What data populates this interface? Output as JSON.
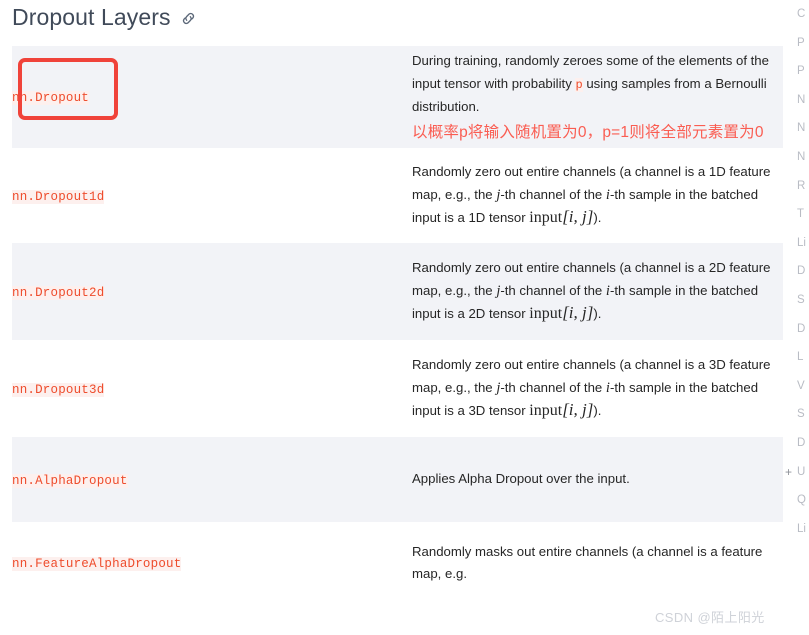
{
  "heading": {
    "title": "Dropout Layers",
    "anchor_icon": "link-icon"
  },
  "table": {
    "rows": [
      {
        "name": "nn.Dropout",
        "desc_pre": "During training, randomly zeroes some of the elements of the input tensor with probability ",
        "desc_var": "p",
        "desc_post": " using samples from a Bernoulli distribution.",
        "annotation_cn": "以概率p将输入随机置为0，p=1则将全部元素置为0",
        "striped": true,
        "highlighted": true
      },
      {
        "name": "nn.Dropout1d",
        "desc_pre": "Randomly zero out entire channels (a channel is a 1D feature map, e.g., the ",
        "var_j": "j",
        "desc_mid": "-th channel of the ",
        "var_i": "i",
        "desc_mid2": "-th sample in the batched input is a 1D tensor ",
        "math_input": "input",
        "math_index": "[i, j]",
        "desc_post": ").",
        "striped": false,
        "highlighted": false
      },
      {
        "name": "nn.Dropout2d",
        "desc_pre": "Randomly zero out entire channels (a channel is a 2D feature map, e.g., the ",
        "var_j": "j",
        "desc_mid": "-th channel of the ",
        "var_i": "i",
        "desc_mid2": "-th sample in the batched input is a 2D tensor ",
        "math_input": "input",
        "math_index": "[i, j]",
        "desc_post": ").",
        "striped": true,
        "highlighted": false
      },
      {
        "name": "nn.Dropout3d",
        "desc_pre": "Randomly zero out entire channels (a channel is a 3D feature map, e.g., the ",
        "var_j": "j",
        "desc_mid": "-th channel of the ",
        "var_i": "i",
        "desc_mid2": "-th sample in the batched input is a 3D tensor ",
        "math_input": "input",
        "math_index": "[i, j]",
        "desc_post": ").",
        "striped": false,
        "highlighted": false
      },
      {
        "name": "nn.AlphaDropout",
        "desc_pre": "Applies Alpha Dropout over the input.",
        "striped": true,
        "highlighted": false
      },
      {
        "name": "nn.FeatureAlphaDropout",
        "desc_pre": "Randomly masks out entire channels (a channel is a feature map, e.g.",
        "striped": false,
        "highlighted": false
      }
    ]
  },
  "right_sidebar": {
    "items": [
      {
        "label": "C",
        "expandable": false
      },
      {
        "label": "P",
        "expandable": false
      },
      {
        "label": "P",
        "expandable": false
      },
      {
        "label": "N",
        "expandable": false
      },
      {
        "label": "N",
        "expandable": false
      },
      {
        "label": "N",
        "expandable": false
      },
      {
        "label": "R",
        "expandable": false
      },
      {
        "label": "T",
        "expandable": false
      },
      {
        "label": "Li",
        "expandable": false
      },
      {
        "label": "D",
        "expandable": false
      },
      {
        "label": "S",
        "expandable": false
      },
      {
        "label": "D",
        "expandable": false
      },
      {
        "label": "L",
        "expandable": false
      },
      {
        "label": "V",
        "expandable": false
      },
      {
        "label": "S",
        "expandable": false
      },
      {
        "label": "D",
        "expandable": false
      },
      {
        "label": "U",
        "expandable": true,
        "expand_glyph": "+"
      },
      {
        "label": "Q",
        "expandable": false
      },
      {
        "label": "Li",
        "expandable": false
      }
    ]
  },
  "watermark": {
    "text": "CSDN @陌上阳光"
  },
  "colors": {
    "accent_code": "#ee4c2c",
    "highlight_border": "#f0433a",
    "annotation": "#fa5d52",
    "stripe_bg": "#f2f3f7",
    "heading": "#404a59"
  }
}
